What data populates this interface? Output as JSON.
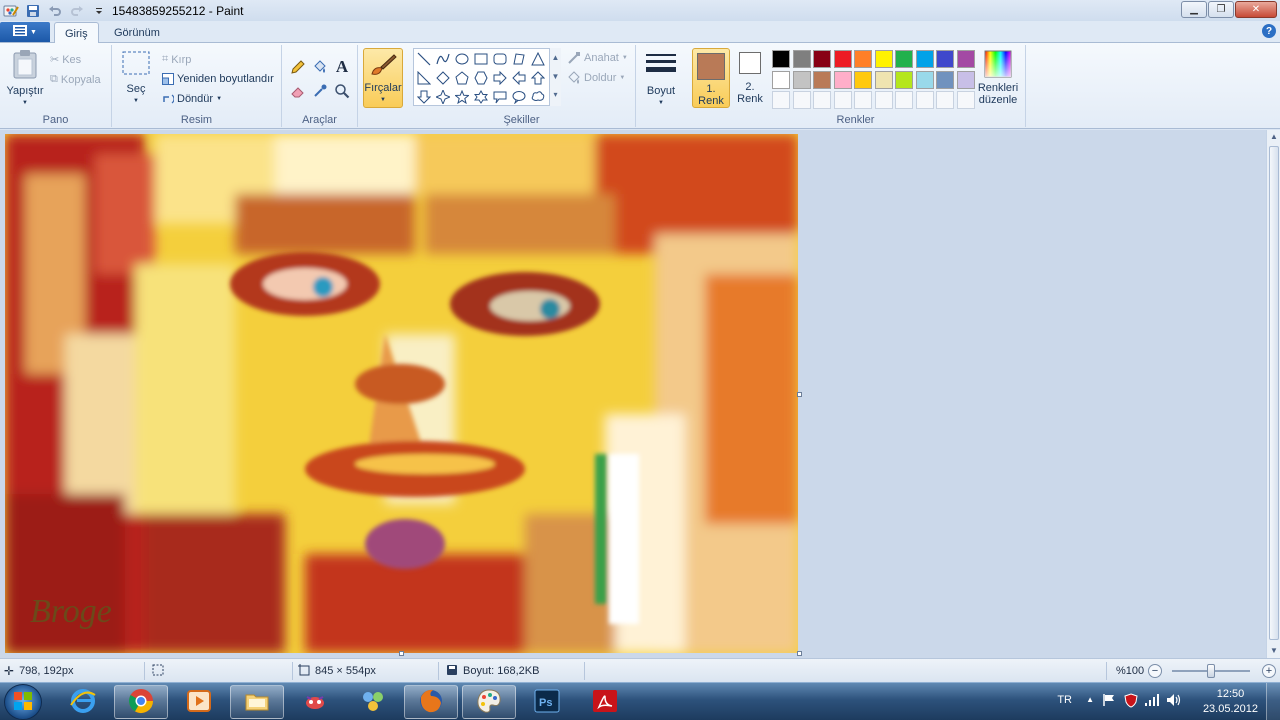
{
  "window": {
    "title": "15483859255212 - Paint"
  },
  "tabs": {
    "home": "Giriş",
    "view": "Görünüm"
  },
  "ribbon": {
    "clipboard": {
      "label": "Pano",
      "paste": "Yapıştır",
      "cut": "Kes",
      "copy": "Kopyala"
    },
    "image": {
      "label": "Resim",
      "select": "Seç",
      "crop": "Kırp",
      "resize": "Yeniden boyutlandır",
      "rotate": "Döndür"
    },
    "tools": {
      "label": "Araçlar"
    },
    "brushes": {
      "label": "Fırçalar"
    },
    "shapes": {
      "label": "Şekiller",
      "outline": "Anahat",
      "fill": "Doldur"
    },
    "size": {
      "label": "Boyut"
    },
    "colors": {
      "label": "Renkler",
      "color1_num": "1.",
      "color1_word": "Renk",
      "color2_num": "2.",
      "color2_word": "Renk",
      "edit_line1": "Renkleri",
      "edit_line2": "düzenle",
      "color1_value": "#b97a57",
      "color2_value": "#ffffff",
      "palette_row1": [
        "#000000",
        "#7f7f7f",
        "#880015",
        "#ed1c24",
        "#ff7f27",
        "#fff200",
        "#22b14c",
        "#00a2e8",
        "#3f48cc",
        "#a349a4"
      ],
      "palette_row2": [
        "#ffffff",
        "#c3c3c3",
        "#b97a57",
        "#ffaec9",
        "#ffc90e",
        "#efe4b0",
        "#b5e61d",
        "#99d9ea",
        "#7092be",
        "#c8bfe7"
      ]
    }
  },
  "canvas": {
    "signature": "Broge"
  },
  "status": {
    "cursor_pos": "798, 192px",
    "image_size": "845 × 554px",
    "file_size": "Boyut: 168,2KB",
    "zoom": "%100"
  },
  "taskbar": {
    "language": "TR",
    "time": "12:50",
    "date": "23.05.2012"
  }
}
